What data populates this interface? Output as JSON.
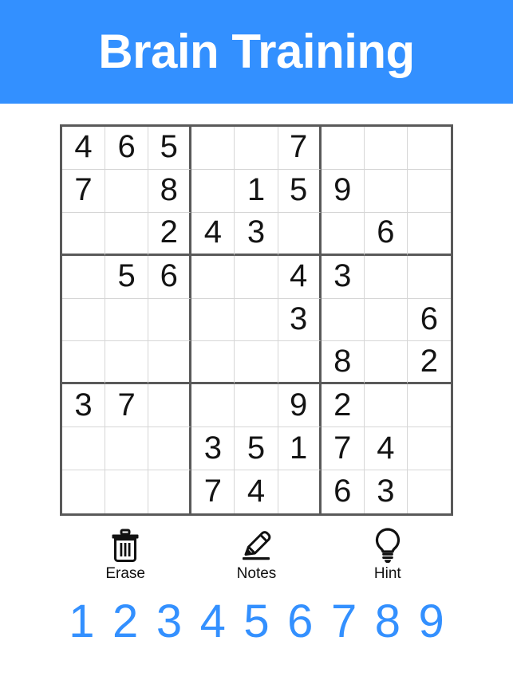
{
  "theme": {
    "accent": "#3390ff",
    "header_bg": "#3390ff",
    "header_text": "#ffffff",
    "page_bg": "#ffffff",
    "grid_thick_line": "#595959",
    "grid_thin_line": "#d6d6d6",
    "given_digit": "#141414",
    "numpad_digit": "#3390ff",
    "tool_label": "#111111"
  },
  "header": {
    "title": "Brain Training"
  },
  "board": {
    "size": 9,
    "box_size": 3,
    "rows": [
      [
        "4",
        "6",
        "5",
        "",
        "",
        "7",
        "",
        "",
        ""
      ],
      [
        "7",
        "",
        "8",
        "",
        "1",
        "5",
        "9",
        "",
        ""
      ],
      [
        "",
        "",
        "2",
        "4",
        "3",
        "",
        "",
        "6",
        ""
      ],
      [
        "",
        "5",
        "6",
        "",
        "",
        "4",
        "3",
        "",
        ""
      ],
      [
        "",
        "",
        "",
        "",
        "",
        "3",
        "",
        "",
        "6"
      ],
      [
        "",
        "",
        "",
        "",
        "",
        "",
        "8",
        "",
        "2"
      ],
      [
        "3",
        "7",
        "",
        "",
        "",
        "9",
        "2",
        "",
        ""
      ],
      [
        "",
        "",
        "",
        "3",
        "5",
        "1",
        "7",
        "4",
        ""
      ],
      [
        "",
        "",
        "",
        "7",
        "4",
        "",
        "6",
        "3",
        ""
      ]
    ]
  },
  "tools": [
    {
      "id": "erase",
      "label": "Erase",
      "icon": "trash-icon"
    },
    {
      "id": "notes",
      "label": "Notes",
      "icon": "pencil-icon"
    },
    {
      "id": "hint",
      "label": "Hint",
      "icon": "lightbulb-icon"
    }
  ],
  "numpad": {
    "digits": [
      "1",
      "2",
      "3",
      "4",
      "5",
      "6",
      "7",
      "8",
      "9"
    ]
  }
}
